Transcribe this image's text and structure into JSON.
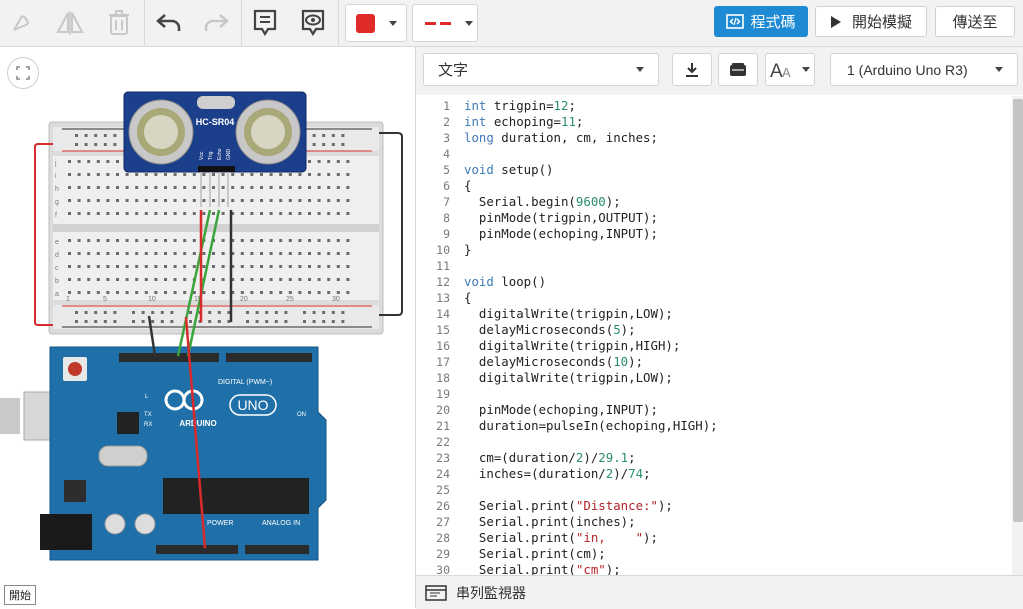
{
  "toolbar": {
    "icons": [
      "rotate-icon",
      "mirror-icon",
      "trash-icon",
      "undo-icon",
      "redo-icon",
      "notes-icon",
      "visibility-icon"
    ],
    "color_value": "#e02a2a",
    "wire_color_value": "#e02a2a",
    "code_button_label": "程式碼",
    "simulate_button_label": "開始模擬",
    "send_button_label": "傳送至",
    "accent_color": "#1d8ad3"
  },
  "canvas": {
    "status_label": "開始",
    "sensor_label": "HC-SR04",
    "sensor_pins": [
      "Vcc",
      "Trig",
      "Echo",
      "GND"
    ],
    "arduino_brand": "ARDUINO",
    "arduino_model": "UNO",
    "header_digital_label": "DIGITAL (PWM~)",
    "header_power_label": "POWER",
    "header_analog_label": "ANALOG IN",
    "tx_label": "TX",
    "rx_label": "RX",
    "on_label": "ON",
    "l_label": "L",
    "breadboard_rows_top": [
      "j",
      "i",
      "h",
      "g",
      "f"
    ],
    "breadboard_rows_bottom": [
      "e",
      "d",
      "c",
      "b",
      "a"
    ],
    "breadboard_cols": [
      "1",
      "5",
      "10",
      "15",
      "20",
      "25",
      "30"
    ]
  },
  "code_panel": {
    "language": "文字",
    "device": "1 (Arduino Uno R3)",
    "serial_monitor_label": "串列監視器",
    "code_lines": [
      [
        [
          "typ",
          "int"
        ],
        [
          "pl",
          " trigpin="
        ],
        [
          "num",
          "12"
        ],
        [
          "pl",
          ";"
        ]
      ],
      [
        [
          "typ",
          "int"
        ],
        [
          "pl",
          " echoping="
        ],
        [
          "num",
          "11"
        ],
        [
          "pl",
          ";"
        ]
      ],
      [
        [
          "typ",
          "long"
        ],
        [
          "pl",
          " duration, cm, inches;"
        ]
      ],
      [],
      [
        [
          "kw",
          "void"
        ],
        [
          "pl",
          " setup()"
        ]
      ],
      [
        [
          "pl",
          "{"
        ]
      ],
      [
        [
          "pl",
          "  Serial.begin("
        ],
        [
          "num",
          "9600"
        ],
        [
          "pl",
          ");"
        ]
      ],
      [
        [
          "pl",
          "  pinMode(trigpin,OUTPUT);"
        ]
      ],
      [
        [
          "pl",
          "  pinMode(echoping,INPUT);"
        ]
      ],
      [
        [
          "pl",
          "}"
        ]
      ],
      [],
      [
        [
          "kw",
          "void"
        ],
        [
          "pl",
          " loop()"
        ]
      ],
      [
        [
          "pl",
          "{"
        ]
      ],
      [
        [
          "pl",
          "  digitalWrite(trigpin,LOW);"
        ]
      ],
      [
        [
          "pl",
          "  delayMicroseconds("
        ],
        [
          "num",
          "5"
        ],
        [
          "pl",
          ");"
        ]
      ],
      [
        [
          "pl",
          "  digitalWrite(trigpin,HIGH);"
        ]
      ],
      [
        [
          "pl",
          "  delayMicroseconds("
        ],
        [
          "num",
          "10"
        ],
        [
          "pl",
          ");"
        ]
      ],
      [
        [
          "pl",
          "  digitalWrite(trigpin,LOW);"
        ]
      ],
      [],
      [
        [
          "pl",
          "  pinMode(echoping,INPUT);"
        ]
      ],
      [
        [
          "pl",
          "  duration=pulseIn(echoping,HIGH);"
        ]
      ],
      [],
      [
        [
          "pl",
          "  cm=(duration/"
        ],
        [
          "num",
          "2"
        ],
        [
          "pl",
          ")/"
        ],
        [
          "num",
          "29.1"
        ],
        [
          "pl",
          ";"
        ]
      ],
      [
        [
          "pl",
          "  inches=(duration/"
        ],
        [
          "num",
          "2"
        ],
        [
          "pl",
          ")/"
        ],
        [
          "num",
          "74"
        ],
        [
          "pl",
          ";"
        ]
      ],
      [],
      [
        [
          "pl",
          "  Serial.print("
        ],
        [
          "str",
          "\"Distance:\""
        ],
        [
          "pl",
          ");"
        ]
      ],
      [
        [
          "pl",
          "  Serial.print(inches);"
        ]
      ],
      [
        [
          "pl",
          "  Serial.print("
        ],
        [
          "str",
          "\"in,    \""
        ],
        [
          "pl",
          ");"
        ]
      ],
      [
        [
          "pl",
          "  Serial.print(cm);"
        ]
      ],
      [
        [
          "pl",
          "  Serial.print("
        ],
        [
          "str",
          "\"cm\""
        ],
        [
          "pl",
          ");"
        ]
      ]
    ]
  }
}
